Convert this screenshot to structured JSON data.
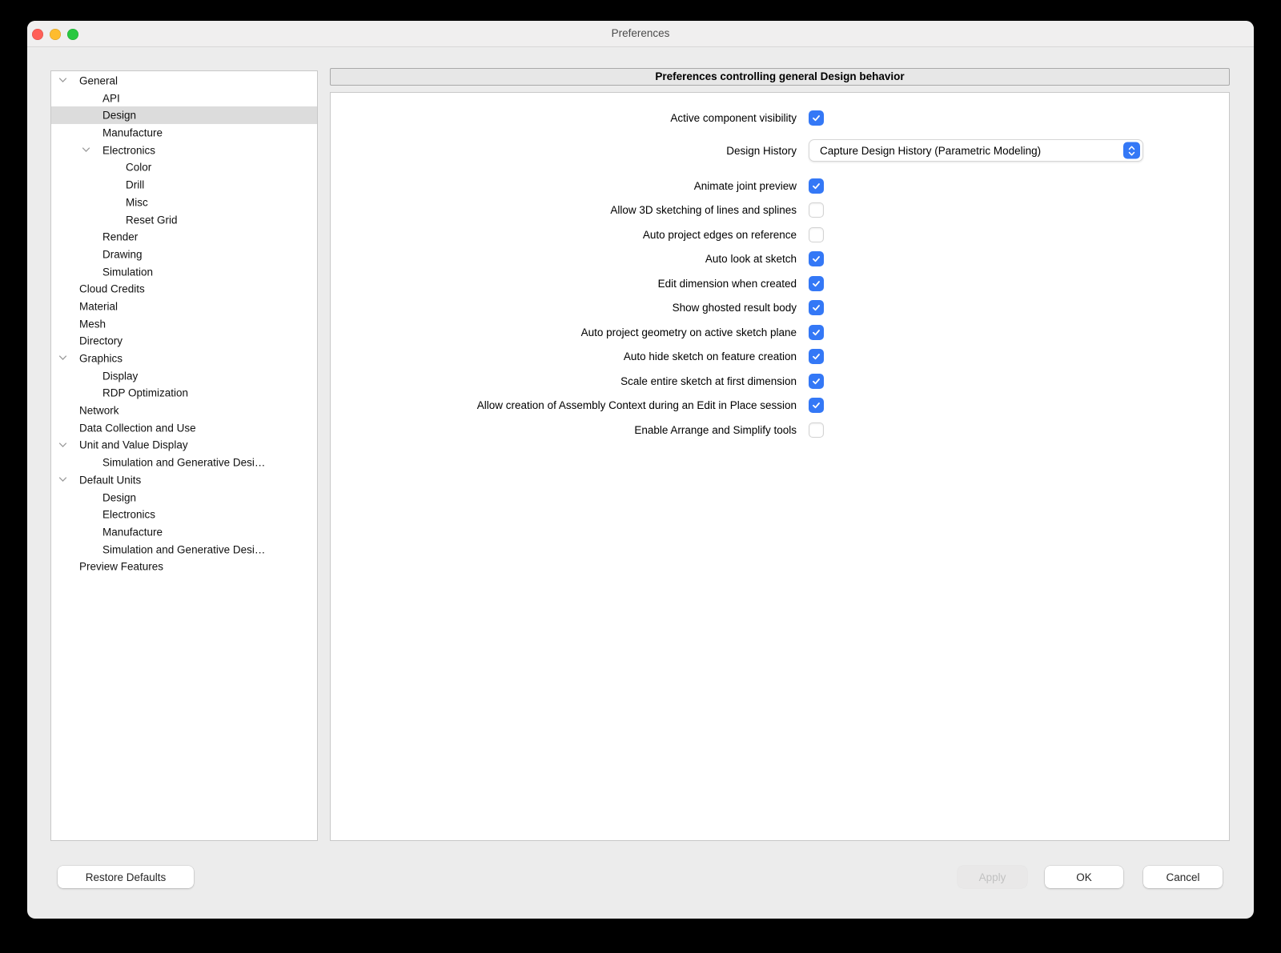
{
  "colors": {
    "accent": "#3478f6",
    "selected_row": "#dcdcdc",
    "traffic_red": "#ff5f57",
    "traffic_yellow": "#febc2e",
    "traffic_green": "#28c840"
  },
  "titlebar": {
    "title": "Preferences",
    "traffic_lights": [
      {
        "name": "close",
        "color": "#ff5f57"
      },
      {
        "name": "minimize",
        "color": "#febc2e"
      },
      {
        "name": "zoom",
        "color": "#28c840"
      }
    ]
  },
  "sidebar": {
    "items": [
      {
        "label": "General",
        "level": 0,
        "expanded": true
      },
      {
        "label": "API",
        "level": 1
      },
      {
        "label": "Design",
        "level": 1,
        "selected": true
      },
      {
        "label": "Manufacture",
        "level": 1
      },
      {
        "label": "Electronics",
        "level": 1,
        "expanded": true
      },
      {
        "label": "Color",
        "level": 2
      },
      {
        "label": "Drill",
        "level": 2
      },
      {
        "label": "Misc",
        "level": 2
      },
      {
        "label": "Reset Grid",
        "level": 2
      },
      {
        "label": "Render",
        "level": 1
      },
      {
        "label": "Drawing",
        "level": 1
      },
      {
        "label": "Simulation",
        "level": 1
      },
      {
        "label": "Cloud Credits",
        "level": 0
      },
      {
        "label": "Material",
        "level": 0
      },
      {
        "label": "Mesh",
        "level": 0
      },
      {
        "label": "Directory",
        "level": 0
      },
      {
        "label": "Graphics",
        "level": 0,
        "expanded": true
      },
      {
        "label": "Display",
        "level": 1
      },
      {
        "label": "RDP Optimization",
        "level": 1
      },
      {
        "label": "Network",
        "level": 0
      },
      {
        "label": "Data Collection and Use",
        "level": 0
      },
      {
        "label": "Unit and Value Display",
        "level": 0,
        "expanded": true
      },
      {
        "label": "Simulation and Generative Desi…",
        "level": 1
      },
      {
        "label": "Default Units",
        "level": 0,
        "expanded": true
      },
      {
        "label": "Design",
        "level": 1
      },
      {
        "label": "Electronics",
        "level": 1
      },
      {
        "label": "Manufacture",
        "level": 1
      },
      {
        "label": "Simulation and Generative Desi…",
        "level": 1
      },
      {
        "label": "Preview Features",
        "level": 0
      }
    ]
  },
  "panel": {
    "header": "Preferences controlling general Design behavior",
    "rows": [
      {
        "type": "checkbox",
        "label": "Active component visibility",
        "checked": true
      },
      {
        "type": "select",
        "label": "Design History",
        "value": "Capture Design History (Parametric Modeling)"
      },
      {
        "type": "checkbox",
        "label": "Animate joint preview",
        "checked": true
      },
      {
        "type": "checkbox",
        "label": "Allow 3D sketching of lines and splines",
        "checked": false
      },
      {
        "type": "checkbox",
        "label": "Auto project edges on reference",
        "checked": false
      },
      {
        "type": "checkbox",
        "label": "Auto look at sketch",
        "checked": true
      },
      {
        "type": "checkbox",
        "label": "Edit dimension when created",
        "checked": true
      },
      {
        "type": "checkbox",
        "label": "Show ghosted result body",
        "checked": true
      },
      {
        "type": "checkbox",
        "label": "Auto project geometry on active sketch plane",
        "checked": true
      },
      {
        "type": "checkbox",
        "label": "Auto hide sketch on feature creation",
        "checked": true
      },
      {
        "type": "checkbox",
        "label": "Scale entire sketch at first dimension",
        "checked": true
      },
      {
        "type": "checkbox",
        "label": "Allow creation of Assembly Context during an Edit in Place session",
        "checked": true
      },
      {
        "type": "checkbox",
        "label": "Enable Arrange and Simplify tools",
        "checked": false
      }
    ]
  },
  "footer": {
    "restore": "Restore Defaults",
    "apply": "Apply",
    "ok": "OK",
    "cancel": "Cancel"
  }
}
